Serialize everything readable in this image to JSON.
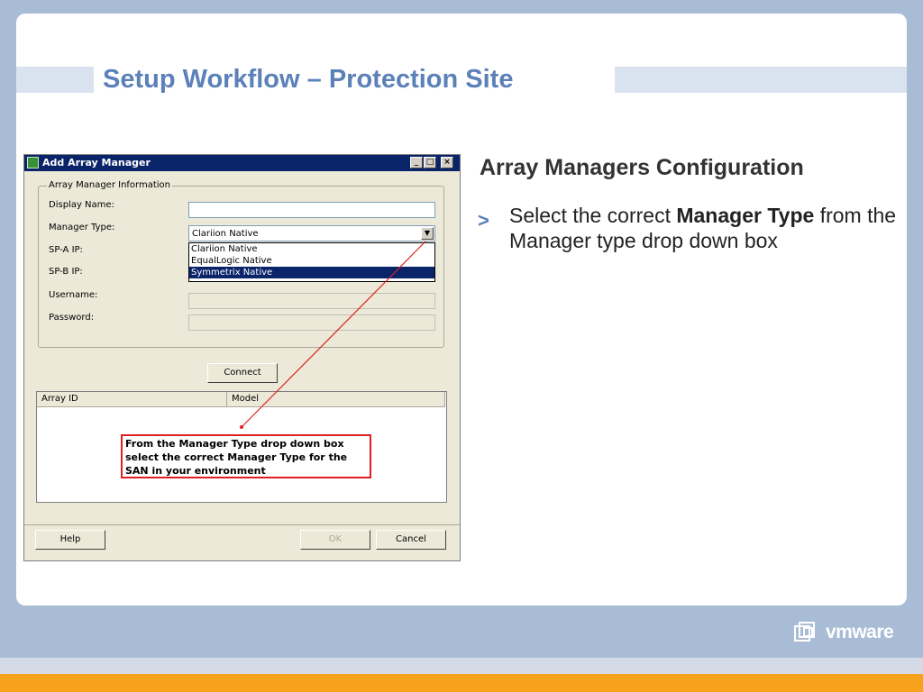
{
  "slide": {
    "title": "Setup Workflow – Protection Site",
    "heading": "Array Managers Configuration",
    "bullet": {
      "prefix": "Select the correct ",
      "bold": "Manager Type",
      "suffix": " from the Manager type drop down box"
    },
    "callout": "From the Manager Type drop down box select the correct Manager Type for the SAN in your environment",
    "logo_text": "vmware",
    "colors": {
      "accent": "#5b81b8",
      "background": "#a9bcd6",
      "callout_border": "#e02020",
      "footer_stripe": "#f7a21b"
    }
  },
  "dialog": {
    "title": "Add Array Manager",
    "window_buttons": {
      "minimize": "_",
      "maximize": "□",
      "close": "×"
    },
    "group_label": "Array Manager Information",
    "fields": {
      "display_name": {
        "label": "Display Name:",
        "value": ""
      },
      "manager_type": {
        "label": "Manager Type:",
        "value": "Clariion Native"
      },
      "spa_ip": {
        "label": "SP-A IP:"
      },
      "spb_ip": {
        "label": "SP-B IP:"
      },
      "username": {
        "label": "Username:",
        "value": ""
      },
      "password": {
        "label": "Password:",
        "value": ""
      }
    },
    "dropdown_options": [
      "Clariion Native",
      "EqualLogic Native",
      "Symmetrix Native"
    ],
    "selected_option": "Symmetrix Native",
    "connect_label": "Connect",
    "table_headers": [
      "Array ID",
      "Model"
    ],
    "help_label": "Help",
    "ok_label": "OK",
    "cancel_label": "Cancel"
  }
}
